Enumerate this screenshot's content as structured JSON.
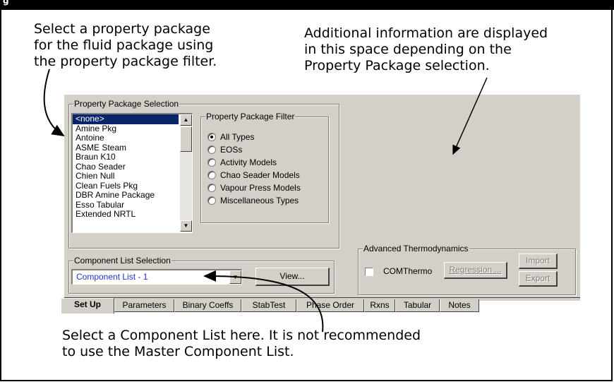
{
  "figure_caption_fragment": "g",
  "callouts": {
    "property_filter": "Select a property package\nfor the fluid package using\nthe property package filter.",
    "additional_info": "Additional information are displayed\nin this space depending on the\nProperty Package selection.",
    "component_list": "Select a Component List here. It is not recommended\nto use the Master Component List."
  },
  "property_package_selection": {
    "title": "Property Package Selection",
    "items": [
      "<none>",
      "Amine Pkg",
      "Antoine",
      "ASME Steam",
      "Braun K10",
      "Chao Seader",
      "Chien Null",
      "Clean Fuels Pkg",
      "DBR Amine Package",
      "Esso Tabular",
      "Extended NRTL"
    ],
    "selected": "<none>"
  },
  "property_package_filter": {
    "title": "Property Package Filter",
    "options": [
      "All Types",
      "EOSs",
      "Activity Models",
      "Chao Seader Models",
      "Vapour Press Models",
      "Miscellaneous Types"
    ],
    "selected": "All Types"
  },
  "component_list_selection": {
    "title": "Component List Selection",
    "value": "Component List - 1",
    "view_label": "View..."
  },
  "advanced_thermodynamics": {
    "title": "Advanced Thermodynamics",
    "comthermo_label": "COMThermo",
    "comthermo_checked": false,
    "regression_label": "Regression ...",
    "import_label": "Import",
    "export_label": "Export"
  },
  "tabs": [
    "Set Up",
    "Parameters",
    "Binary Coeffs",
    "StabTest",
    "Phase Order",
    "Rxns",
    "Tabular",
    "Notes"
  ],
  "active_tab": "Set Up"
}
